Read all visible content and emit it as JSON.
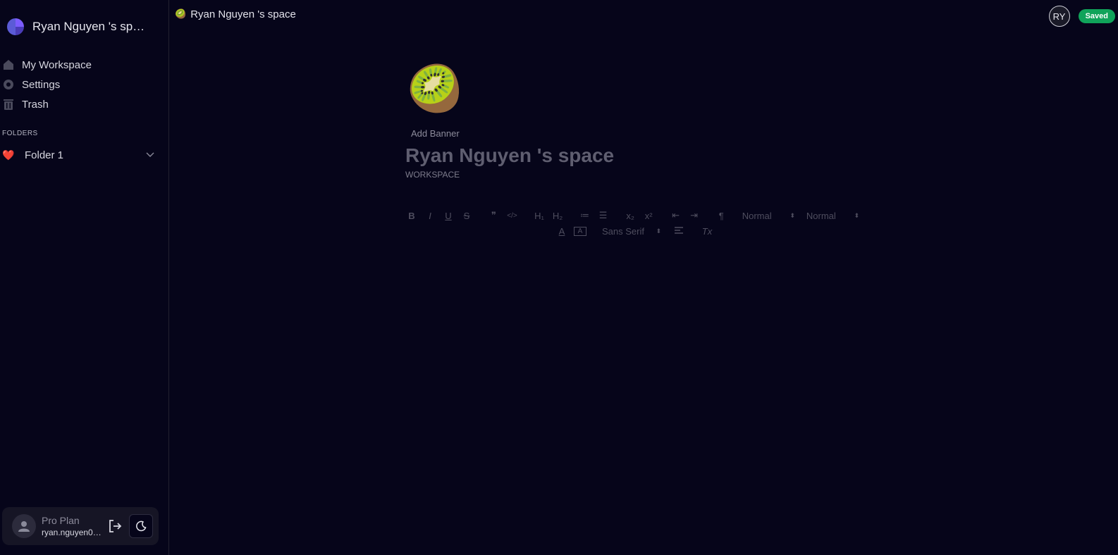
{
  "sidebar": {
    "workspace_title": "Ryan Nguyen 's space",
    "nav": [
      {
        "label": "My Workspace",
        "icon": "home-icon"
      },
      {
        "label": "Settings",
        "icon": "gear-icon"
      },
      {
        "label": "Trash",
        "icon": "trash-icon"
      }
    ],
    "folders_label": "FOLDERS",
    "folders": [
      {
        "emoji": "❤️",
        "label": "Folder 1"
      }
    ],
    "user": {
      "plan": "Pro Plan",
      "email": "ryan.nguyen07..."
    }
  },
  "header": {
    "breadcrumb_emoji": "🥝",
    "breadcrumb": "Ryan Nguyen 's space",
    "collaborator_initials": "RY",
    "status": "Saved"
  },
  "page": {
    "emoji": "🥝",
    "add_banner": "Add Banner",
    "title": "Ryan Nguyen 's space",
    "subtitle": "WORKSPACE"
  },
  "toolbar": {
    "buttons_row1": [
      "B",
      "I",
      "U",
      "S",
      "❞",
      "</>",
      "H₁",
      "H₂",
      "≔",
      "☰",
      "x₂",
      "x²",
      "⇤",
      "⇥",
      "¶"
    ],
    "size_select": "Normal",
    "header_select": "Normal",
    "font_select": "Sans Serif",
    "clear_format": "Tx"
  },
  "colors": {
    "background": "#06051a",
    "saved_badge": "#10a35a",
    "folder_icon": "#e0303d"
  }
}
